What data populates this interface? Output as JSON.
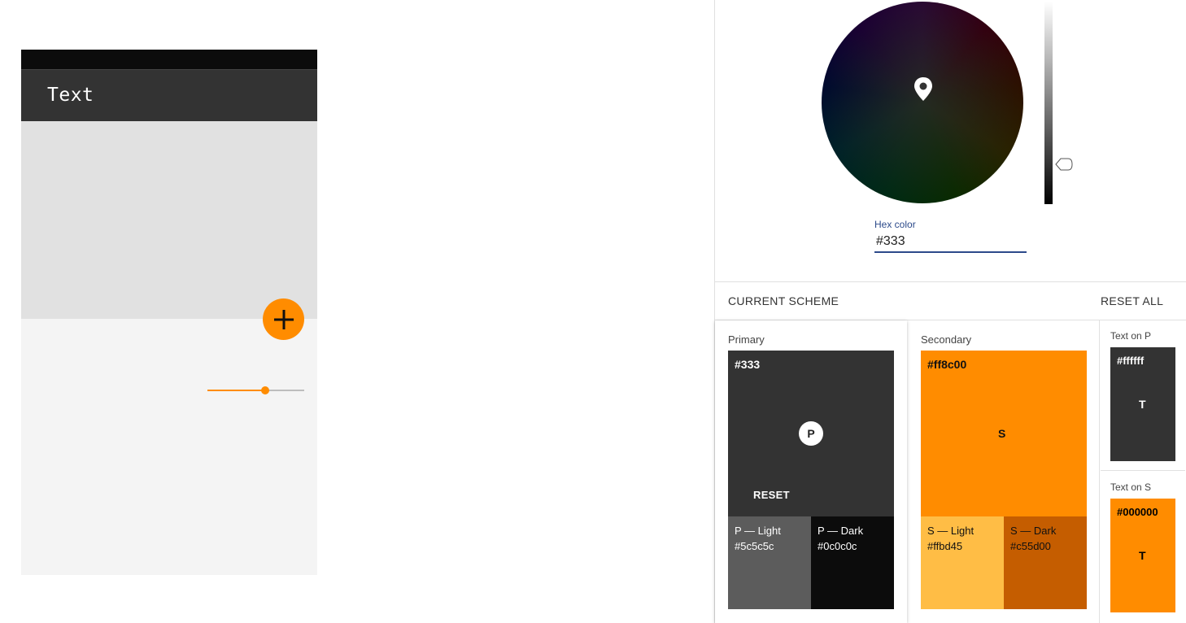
{
  "preview": {
    "app_bar_title": "Text",
    "colors": {
      "status_bar": "#0c0c0c",
      "app_bar": "#333333",
      "content": "#e1e1e1",
      "background": "#f4f4f4",
      "accent": "#ff8c00"
    },
    "fab_icon": "plus-icon",
    "slider_value_percent": 60
  },
  "picker": {
    "hex_label": "Hex color",
    "hex_value": "#333"
  },
  "scheme": {
    "header": "CURRENT SCHEME",
    "reset_all": "RESET ALL",
    "primary": {
      "label": "Primary",
      "hex": "#333",
      "letter": "P",
      "reset": "RESET",
      "light_label": "P — Light",
      "light_hex": "#5c5c5c",
      "dark_label": "P — Dark",
      "dark_hex": "#0c0c0c"
    },
    "secondary": {
      "label": "Secondary",
      "hex": "#ff8c00",
      "letter": "S",
      "light_label": "S — Light",
      "light_hex": "#ffbd45",
      "dark_label": "S — Dark",
      "dark_hex": "#c55d00"
    },
    "text_on_p": {
      "label": "Text on P",
      "hex": "#ffffff",
      "letter": "T"
    },
    "text_on_s": {
      "label": "Text on S",
      "hex": "#000000",
      "letter": "T"
    }
  }
}
